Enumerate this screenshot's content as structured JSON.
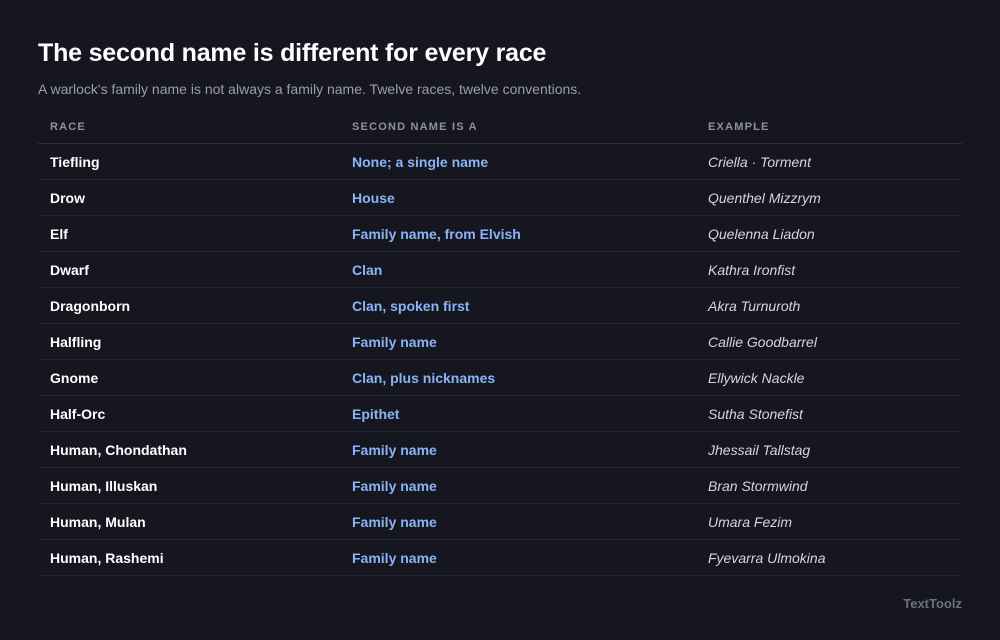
{
  "header": {
    "title": "The second name is different for every race",
    "subtitle": "A warlock's family name is not always a family name. Twelve races, twelve conventions."
  },
  "table": {
    "columns": [
      "RACE",
      "SECOND NAME IS A",
      "EXAMPLE"
    ],
    "rows": [
      {
        "race": "Tiefling",
        "second": "None; a single name",
        "example": "Criella · Torment"
      },
      {
        "race": "Drow",
        "second": "House",
        "example": "Quenthel Mizzrym"
      },
      {
        "race": "Elf",
        "second": "Family name, from Elvish",
        "example": "Quelenna Liadon"
      },
      {
        "race": "Dwarf",
        "second": "Clan",
        "example": "Kathra Ironfist"
      },
      {
        "race": "Dragonborn",
        "second": "Clan, spoken first",
        "example": "Akra Turnuroth"
      },
      {
        "race": "Halfling",
        "second": "Family name",
        "example": "Callie Goodbarrel"
      },
      {
        "race": "Gnome",
        "second": "Clan, plus nicknames",
        "example": "Ellywick Nackle"
      },
      {
        "race": "Half-Orc",
        "second": "Epithet",
        "example": "Sutha Stonefist"
      },
      {
        "race": "Human, Chondathan",
        "second": "Family name",
        "example": "Jhessail Tallstag"
      },
      {
        "race": "Human, Illuskan",
        "second": "Family name",
        "example": "Bran Stormwind"
      },
      {
        "race": "Human, Mulan",
        "second": "Family name",
        "example": "Umara Fezim"
      },
      {
        "race": "Human, Rashemi",
        "second": "Family name",
        "example": "Fyevarra Ulmokina"
      }
    ]
  },
  "footer": {
    "brand": "TextToolz"
  },
  "colors": {
    "background": "#15161f",
    "accent": "#8ab4f8"
  }
}
